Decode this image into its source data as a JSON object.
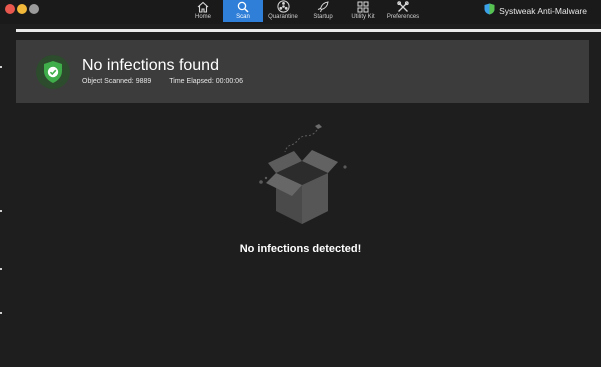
{
  "window": {
    "traffic_colors": [
      "#e8584e",
      "#f1b83a",
      "#9b9b9b"
    ]
  },
  "nav": {
    "items": [
      {
        "label": "Home",
        "icon": "home-icon"
      },
      {
        "label": "Scan",
        "icon": "search-icon",
        "active": true
      },
      {
        "label": "Quarantine",
        "icon": "biohazard-icon"
      },
      {
        "label": "Startup",
        "icon": "rocket-icon"
      },
      {
        "label": "Utility Kit",
        "icon": "grid-icon"
      },
      {
        "label": "Preferences",
        "icon": "tools-icon"
      }
    ]
  },
  "brand": {
    "name": "Systweak Anti-Malware",
    "icon": "shield-logo-icon",
    "color": "#3aa0e8"
  },
  "result": {
    "title": "No infections found",
    "objects_scanned": "Object Scanned: 9889",
    "time_elapsed": "Time Elapsed: 00:00:06",
    "status_color": "#3fae4a"
  },
  "empty_state": {
    "message": "No infections detected!",
    "icon": "open-box-icon"
  }
}
